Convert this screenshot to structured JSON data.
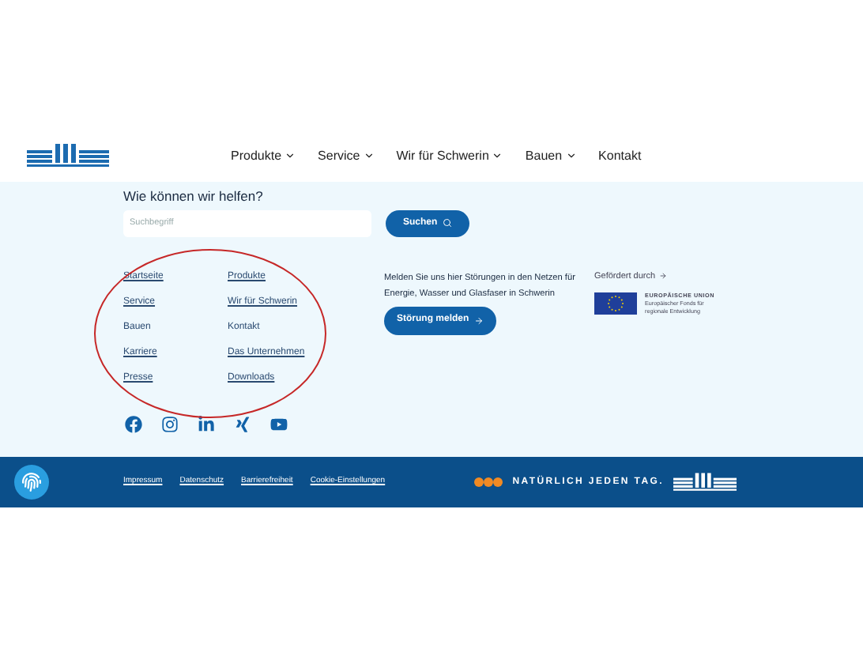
{
  "nav": [
    {
      "label": "Produkte",
      "dropdown": true
    },
    {
      "label": "Service",
      "dropdown": true
    },
    {
      "label": "Wir für Schwerin",
      "dropdown": true
    },
    {
      "label": "Bauen",
      "dropdown": true
    },
    {
      "label": "Kontakt",
      "dropdown": false
    }
  ],
  "search": {
    "heading": "Wie können wir helfen?",
    "placeholder": "Suchbegriff",
    "button": "Suchen"
  },
  "links": [
    [
      {
        "label": "Startseite",
        "underlined": true
      },
      {
        "label": "Service",
        "underlined": true
      },
      {
        "label": "Bauen",
        "underlined": false
      },
      {
        "label": "Karriere",
        "underlined": true
      },
      {
        "label": "Presse",
        "underlined": true
      }
    ],
    [
      {
        "label": "Produkte",
        "underlined": true
      },
      {
        "label": "Wir für Schwerin",
        "underlined": true
      },
      {
        "label": "Kontakt",
        "underlined": false
      },
      {
        "label": "Das Unternehmen",
        "underlined": true
      },
      {
        "label": "Downloads",
        "underlined": true
      }
    ]
  ],
  "social": [
    {
      "kind": "facebook"
    },
    {
      "kind": "instagram"
    },
    {
      "kind": "linkedin"
    },
    {
      "kind": "xing"
    },
    {
      "kind": "youtube"
    }
  ],
  "outage": {
    "text": "Melden Sie uns hier Störungen in den Netzen für Energie, Wasser und Glasfaser in Schwerin",
    "button": "Störung melden"
  },
  "funding": {
    "label": "Gefördert durch",
    "org": "EUROPÄISCHE UNION",
    "fund": "Europäischer Fonds für regionale Entwicklung"
  },
  "footer": {
    "links": [
      "Impressum",
      "Datenschutz",
      "Barrierefreiheit",
      "Cookie-Einstellungen"
    ],
    "slogan": "NATÜRLICH JEDEN TAG."
  }
}
